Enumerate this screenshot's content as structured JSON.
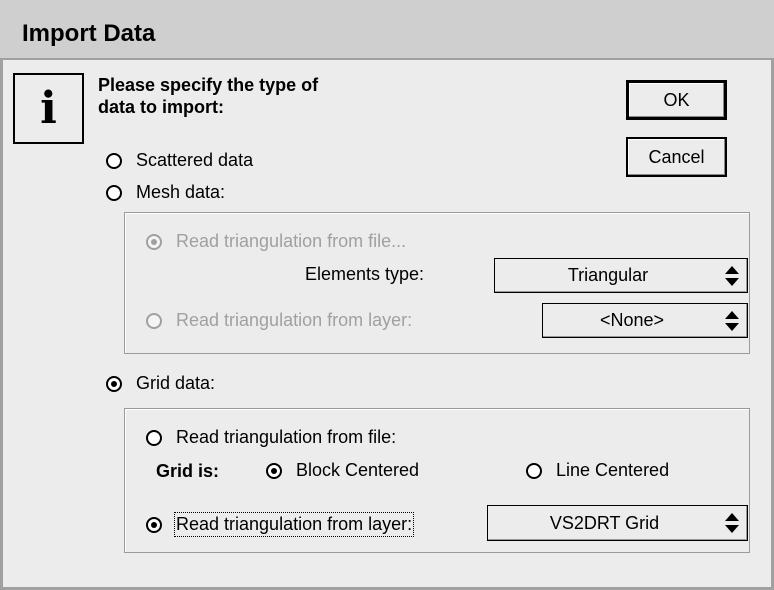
{
  "window": {
    "title": "Import Data"
  },
  "info_icon": "info-icon",
  "prompt": [
    "Please specify the type of",
    "data to import:"
  ],
  "buttons": {
    "ok": "OK",
    "cancel": "Cancel"
  },
  "options": {
    "scattered": {
      "label": "Scattered data",
      "selected": false
    },
    "mesh": {
      "label": "Mesh data:",
      "selected": false
    },
    "grid": {
      "label": "Grid data:",
      "selected": true
    }
  },
  "mesh_group": {
    "from_file": {
      "label": "Read triangulation from file...",
      "selected": true,
      "enabled": false
    },
    "elements_type_label": "Elements type:",
    "elements_type_value": "Triangular",
    "from_layer": {
      "label": "Read triangulation from layer:",
      "selected": false,
      "enabled": false
    },
    "layer_value": "<None>"
  },
  "grid_group": {
    "from_file": {
      "label": "Read triangulation from file:",
      "selected": false
    },
    "grid_is_label": "Grid is:",
    "block_centered": {
      "label": "Block Centered",
      "selected": true
    },
    "line_centered": {
      "label": "Line Centered",
      "selected": false
    },
    "from_layer": {
      "label": "Read triangulation from layer:",
      "selected": true
    },
    "layer_value": "VS2DRT Grid"
  }
}
